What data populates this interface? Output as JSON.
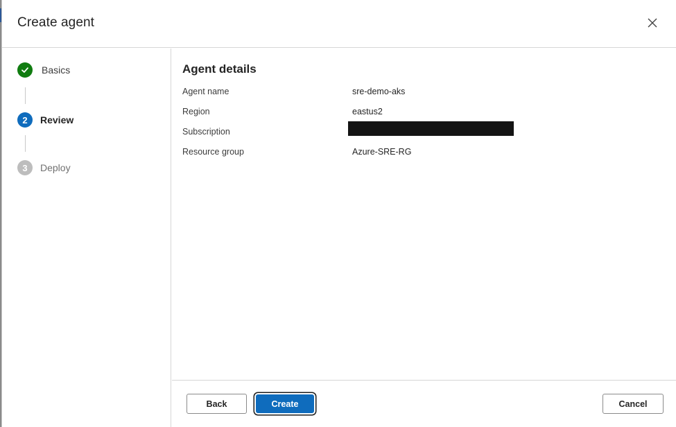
{
  "dialog": {
    "title": "Create agent",
    "close_icon": "close-icon"
  },
  "steps": [
    {
      "number": "",
      "label": "Basics",
      "state": "complete",
      "icon": "checkmark-icon",
      "color": "#107c10"
    },
    {
      "number": "2",
      "label": "Review",
      "state": "current",
      "color": "#0f6cbd"
    },
    {
      "number": "3",
      "label": "Deploy",
      "state": "upcoming",
      "color": "#bdbdbd"
    }
  ],
  "details": {
    "title": "Agent details",
    "rows": [
      {
        "label": "Agent name",
        "value": "sre-demo-aks"
      },
      {
        "label": "Region",
        "value": "eastus2"
      },
      {
        "label": "Subscription",
        "value": "",
        "redacted": true
      },
      {
        "label": "Resource group",
        "value": "Azure-SRE-RG"
      }
    ]
  },
  "footer": {
    "back_label": "Back",
    "create_label": "Create",
    "cancel_label": "Cancel"
  },
  "colors": {
    "primary": "#0f6cbd",
    "success": "#107c10",
    "disabled": "#bdbdbd"
  }
}
